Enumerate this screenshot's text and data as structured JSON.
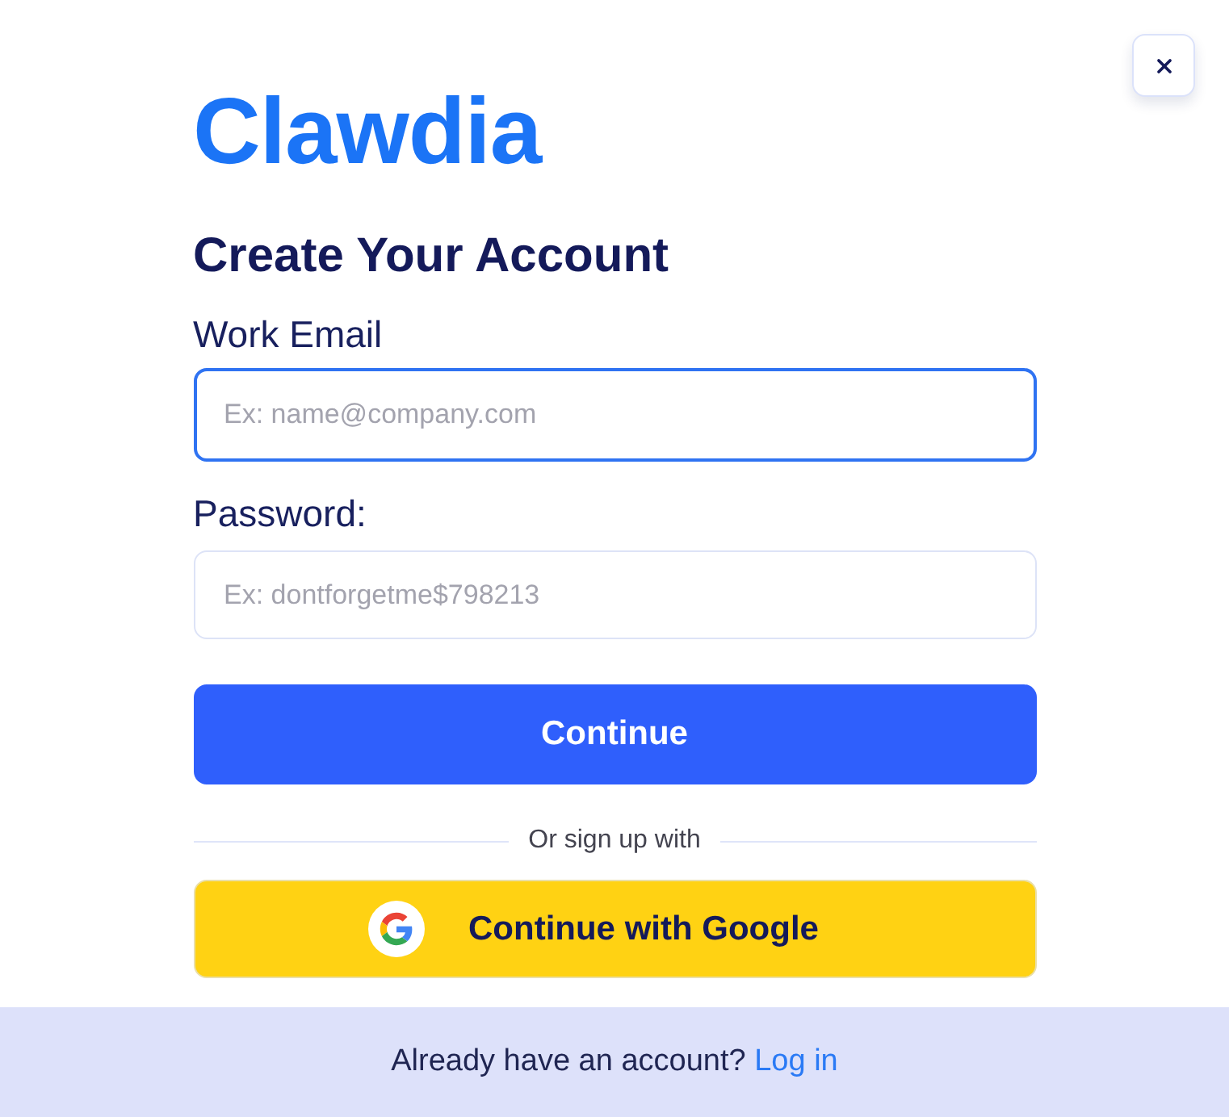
{
  "logo": {
    "text": "Clawdia"
  },
  "heading": "Create Your Account",
  "fields": [
    {
      "label": "Work Email",
      "placeholder": "Ex: name@company.com",
      "focused": true
    },
    {
      "label": "Password:",
      "placeholder": "Ex: dontforgetme$798213",
      "focused": false
    }
  ],
  "primary_button": {
    "label": "Continue"
  },
  "divider": {
    "text": "Or sign up with"
  },
  "google_button": {
    "label": "Continue with Google"
  },
  "footer": {
    "text": "Already have an account?",
    "link": "Log in"
  }
}
